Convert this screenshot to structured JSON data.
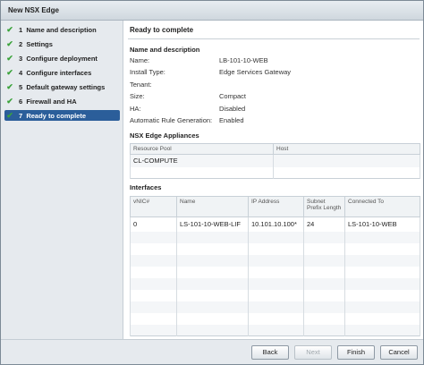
{
  "window": {
    "title": "New NSX Edge"
  },
  "steps": [
    {
      "num": "1",
      "label": "Name and description",
      "done": true
    },
    {
      "num": "2",
      "label": "Settings",
      "done": true
    },
    {
      "num": "3",
      "label": "Configure deployment",
      "done": true
    },
    {
      "num": "4",
      "label": "Configure interfaces",
      "done": true
    },
    {
      "num": "5",
      "label": "Default gateway settings",
      "done": true
    },
    {
      "num": "6",
      "label": "Firewall and HA",
      "done": true
    },
    {
      "num": "7",
      "label": "Ready to complete",
      "done": true,
      "active": true
    }
  ],
  "content": {
    "title": "Ready to complete",
    "name_desc_heading": "Name and description",
    "fields": [
      {
        "key": "Name:",
        "value": "LB-101-10-WEB"
      },
      {
        "key": "Install Type:",
        "value": "Edge Services Gateway"
      },
      {
        "key": "Tenant:",
        "value": ""
      },
      {
        "key": "Size:",
        "value": "Compact"
      },
      {
        "key": "HA:",
        "value": "Disabled"
      },
      {
        "key": "Automatic Rule Generation:",
        "value": "Enabled"
      }
    ],
    "appliances_heading": "NSX Edge Appliances",
    "appliances_columns": [
      "Resource Pool",
      "Host"
    ],
    "appliances_rows": [
      [
        "CL-COMPUTE",
        ""
      ]
    ],
    "interfaces_heading": "Interfaces",
    "interfaces_columns": [
      "vNIC#",
      "Name",
      "IP Address",
      "Subnet Prefix Length",
      "Connected To"
    ],
    "interfaces_rows": [
      [
        "0",
        "LS-101-10-WEB-LIF",
        "10.101.10.100*",
        "24",
        "LS-101-10-WEB"
      ]
    ]
  },
  "buttons": {
    "back": "Back",
    "next": "Next",
    "finish": "Finish",
    "cancel": "Cancel"
  },
  "colors": {
    "active_step": "#2b5e9a",
    "check": "#3ba33b"
  }
}
